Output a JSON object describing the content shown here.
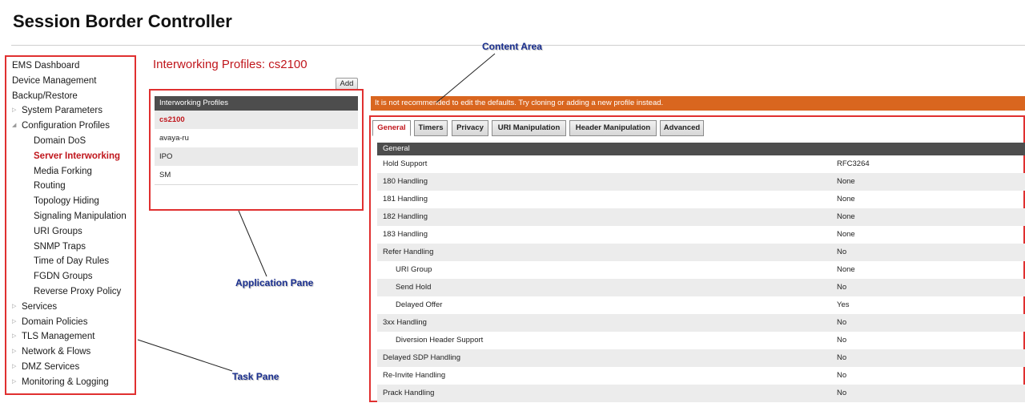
{
  "app_title": "Session Border Controller",
  "task_pane": {
    "items": [
      {
        "label": "EMS Dashboard",
        "level": 0,
        "arrow": ""
      },
      {
        "label": "Device Management",
        "level": 0,
        "arrow": ""
      },
      {
        "label": "Backup/Restore",
        "level": 0,
        "arrow": ""
      },
      {
        "label": "System Parameters",
        "level": 0,
        "arrow": "▷"
      },
      {
        "label": "Configuration Profiles",
        "level": 0,
        "arrow": "◢"
      },
      {
        "label": "Domain DoS",
        "level": 1,
        "arrow": ""
      },
      {
        "label": "Server Interworking",
        "level": 1,
        "arrow": "",
        "active": true
      },
      {
        "label": "Media Forking",
        "level": 1,
        "arrow": ""
      },
      {
        "label": "Routing",
        "level": 1,
        "arrow": ""
      },
      {
        "label": "Topology Hiding",
        "level": 1,
        "arrow": ""
      },
      {
        "label": "Signaling Manipulation",
        "level": 1,
        "arrow": ""
      },
      {
        "label": "URI Groups",
        "level": 1,
        "arrow": ""
      },
      {
        "label": "SNMP Traps",
        "level": 1,
        "arrow": ""
      },
      {
        "label": "Time of Day Rules",
        "level": 1,
        "arrow": ""
      },
      {
        "label": "FGDN Groups",
        "level": 1,
        "arrow": ""
      },
      {
        "label": "Reverse Proxy Policy",
        "level": 1,
        "arrow": ""
      },
      {
        "label": "Services",
        "level": 0,
        "arrow": "▷"
      },
      {
        "label": "Domain Policies",
        "level": 0,
        "arrow": "▷"
      },
      {
        "label": "TLS Management",
        "level": 0,
        "arrow": "▷"
      },
      {
        "label": "Network & Flows",
        "level": 0,
        "arrow": "▷"
      },
      {
        "label": "DMZ Services",
        "level": 0,
        "arrow": "▷"
      },
      {
        "label": "Monitoring & Logging",
        "level": 0,
        "arrow": "▷"
      }
    ]
  },
  "application_pane": {
    "heading": "Interworking Profiles: cs2100",
    "add_label": "Add",
    "table_header": "Interworking Profiles",
    "profiles": [
      {
        "name": "cs2100",
        "selected": true
      },
      {
        "name": "avaya-ru",
        "selected": false
      },
      {
        "name": "IPO",
        "selected": false
      },
      {
        "name": "SM",
        "selected": false
      }
    ]
  },
  "content_area": {
    "warning": "It is not recommended to edit the defaults. Try cloning or adding a new profile instead.",
    "tabs": [
      {
        "label": "General",
        "active": true
      },
      {
        "label": "Timers",
        "active": false
      },
      {
        "label": "Privacy",
        "active": false
      },
      {
        "label": "URI Manipulation",
        "active": false
      },
      {
        "label": "Header Manipulation",
        "active": false
      },
      {
        "label": "Advanced",
        "active": false
      }
    ],
    "section_header": "General",
    "rows": [
      {
        "label": "Hold Support",
        "value": "RFC3264",
        "indent": false
      },
      {
        "label": "180 Handling",
        "value": "None",
        "indent": false
      },
      {
        "label": "181 Handling",
        "value": "None",
        "indent": false
      },
      {
        "label": "182 Handling",
        "value": "None",
        "indent": false
      },
      {
        "label": "183 Handling",
        "value": "None",
        "indent": false
      },
      {
        "label": "Refer Handling",
        "value": "No",
        "indent": false
      },
      {
        "label": "URI Group",
        "value": "None",
        "indent": true
      },
      {
        "label": "Send Hold",
        "value": "No",
        "indent": true
      },
      {
        "label": "Delayed Offer",
        "value": "Yes",
        "indent": true
      },
      {
        "label": "3xx Handling",
        "value": "No",
        "indent": false
      },
      {
        "label": "Diversion Header Support",
        "value": "No",
        "indent": true
      },
      {
        "label": "Delayed SDP Handling",
        "value": "No",
        "indent": false
      },
      {
        "label": "Re-Invite Handling",
        "value": "No",
        "indent": false
      },
      {
        "label": "Prack Handling",
        "value": "No",
        "indent": false
      }
    ]
  },
  "annotations": {
    "content_area": "Content Area",
    "application_pane": "Application Pane",
    "task_pane": "Task Pane"
  },
  "colors": {
    "accent_red": "#c0161c",
    "warning_orange": "#d9661f",
    "callout_blue": "#1a2f8f",
    "table_header": "#4d4d4d"
  }
}
